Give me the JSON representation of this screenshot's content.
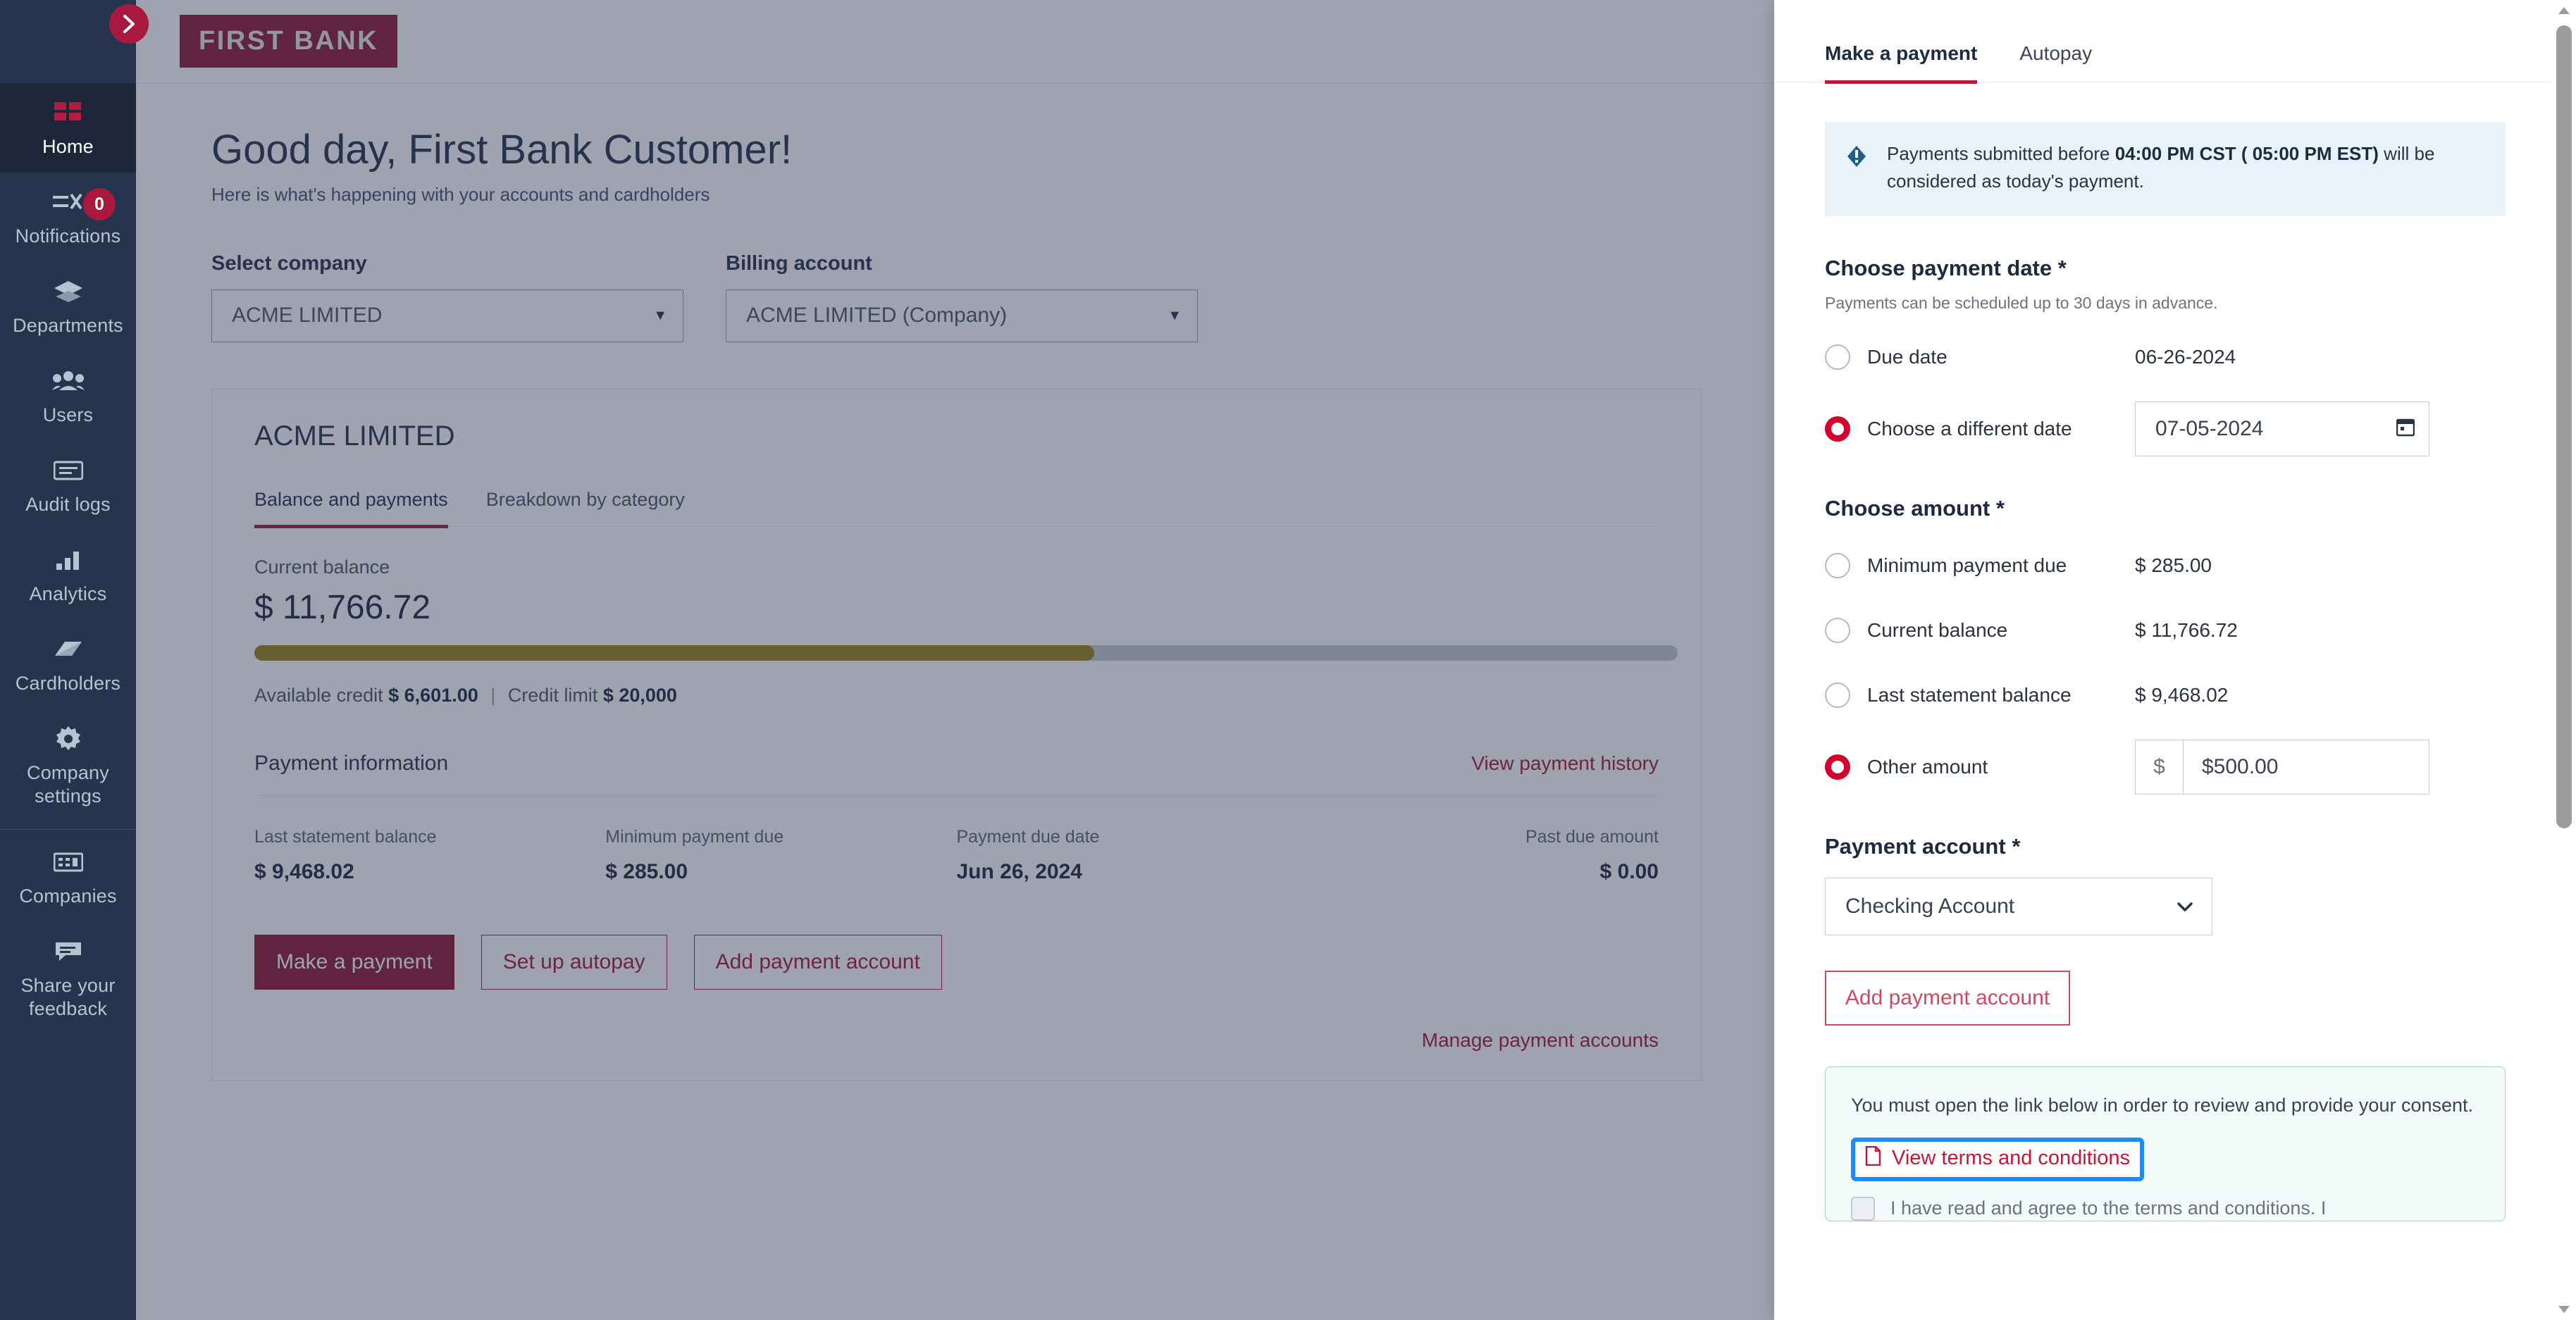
{
  "sidebar": {
    "collapse_icon": "chevron-right-icon",
    "items": [
      {
        "label": "Home",
        "icon": "home-grid-icon",
        "active": true,
        "badge": null
      },
      {
        "label": "Notifications",
        "icon": "bell-list-icon",
        "active": false,
        "badge": "0"
      },
      {
        "label": "Departments",
        "icon": "layers-icon",
        "active": false,
        "badge": null
      },
      {
        "label": "Users",
        "icon": "users-icon",
        "active": false,
        "badge": null
      },
      {
        "label": "Audit logs",
        "icon": "list-card-icon",
        "active": false,
        "badge": null
      },
      {
        "label": "Analytics",
        "icon": "bar-chart-icon",
        "active": false,
        "badge": null
      },
      {
        "label": "Cardholders",
        "icon": "cards-icon",
        "active": false,
        "badge": null
      },
      {
        "label": "Company settings",
        "icon": "gear-icon",
        "active": false,
        "badge": null
      },
      {
        "label": "Companies",
        "icon": "building-icon",
        "active": false,
        "badge": null
      },
      {
        "label": "Share your feedback",
        "icon": "chat-icon",
        "active": false,
        "badge": null
      }
    ]
  },
  "topbar": {
    "logo_text": "FIRST BANK"
  },
  "page": {
    "greeting": "Good day, First Bank Customer!",
    "subgreeting": "Here is what's happening with your accounts and cardholders"
  },
  "selectors": {
    "company": {
      "label": "Select company",
      "value": "ACME LIMITED",
      "caret": "caret-down-icon"
    },
    "billing": {
      "label": "Billing account",
      "value": "ACME LIMITED (Company)",
      "caret": "caret-down-icon"
    }
  },
  "account_card": {
    "title": "ACME LIMITED",
    "tabs": [
      {
        "label": "Balance and payments",
        "active": true
      },
      {
        "label": "Breakdown by category",
        "active": false
      }
    ],
    "current_balance_label": "Current balance",
    "current_balance_value": "$ 11,766.72",
    "progress_percent": 59,
    "available_credit_label": "Available credit",
    "available_credit_value": "$ 6,601.00",
    "separator": "|",
    "credit_limit_label": "Credit limit",
    "credit_limit_value": "$ 20,000",
    "payment_information_title": "Payment information",
    "view_payment_history": "View payment history",
    "info": [
      {
        "label": "Last statement balance",
        "value": "$ 9,468.02"
      },
      {
        "label": "Minimum payment due",
        "value": "$ 285.00"
      },
      {
        "label": "Payment due date",
        "value": "Jun 26, 2024"
      },
      {
        "label": "Past due amount",
        "value": "$ 0.00"
      }
    ],
    "buttons": [
      {
        "label": "Make a payment",
        "style": "primary"
      },
      {
        "label": "Set up autopay",
        "style": "outline"
      },
      {
        "label": "Add payment account",
        "style": "outline"
      }
    ],
    "manage_payment_accounts": "Manage payment accounts"
  },
  "panel": {
    "tabs": [
      {
        "label": "Make a payment",
        "active": true
      },
      {
        "label": "Autopay",
        "active": false
      }
    ],
    "notice": {
      "icon": "info-diamond-icon",
      "text_before": "Payments submitted before ",
      "text_bold": "04:00 PM CST ( 05:00 PM EST)",
      "text_after": " will be considered as today's payment."
    },
    "payment_date": {
      "title": "Choose payment date",
      "required_mark": "*",
      "subtitle": "Payments can be scheduled up to 30 days in advance.",
      "options": [
        {
          "label": "Due date",
          "value": "06-26-2024",
          "selected": false,
          "type": "text"
        },
        {
          "label": "Choose a different date",
          "value": "07-05-2024",
          "selected": true,
          "type": "date",
          "calendar_icon": "calendar-icon"
        }
      ]
    },
    "amount": {
      "title": "Choose amount",
      "required_mark": "*",
      "options": [
        {
          "label": "Minimum payment due",
          "value": "$ 285.00",
          "selected": false,
          "type": "text"
        },
        {
          "label": "Current balance",
          "value": "$ 11,766.72",
          "selected": false,
          "type": "text"
        },
        {
          "label": "Last statement balance",
          "value": "$ 9,468.02",
          "selected": false,
          "type": "text"
        },
        {
          "label": "Other amount",
          "value": "$500.00",
          "prefix": "$",
          "selected": true,
          "type": "input"
        }
      ]
    },
    "payment_account": {
      "title": "Payment account",
      "required_mark": "*",
      "selected": "Checking Account",
      "caret": "chevron-down-icon",
      "add_button": "Add payment account"
    },
    "terms": {
      "message": "You must open the link below in order to review and provide your consent.",
      "link_icon": "document-icon",
      "link_label": "View terms and conditions",
      "checkbox_label": "I have read and agree to the terms and conditions. I",
      "focus_color": "#1a8cff"
    }
  },
  "colors": {
    "brand_red": "#8f1838",
    "accent_red": "#c31835",
    "sidebar_bg": "#27344d",
    "progress_fill": "#9b8416",
    "notice_bg": "#e8f2fa",
    "terms_bg": "#f2fafa"
  }
}
